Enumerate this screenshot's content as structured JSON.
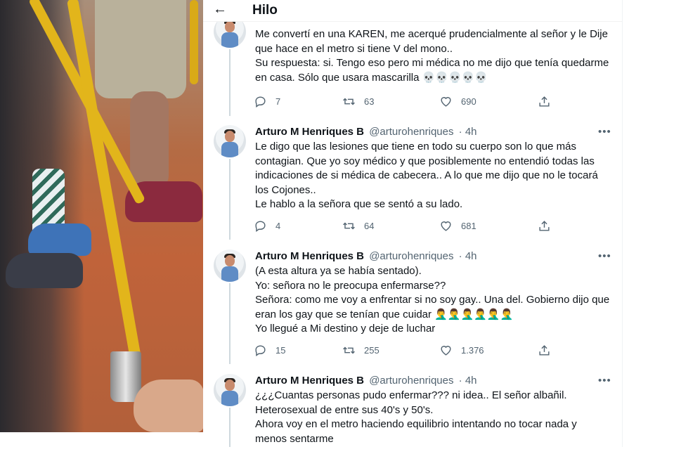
{
  "header": {
    "title": "Hilo"
  },
  "tweets": [
    {
      "name": "",
      "handle": "",
      "time": "",
      "lines": [
        "Me convertí en una KAREN, me acerqué prudencialmente al señor y le Dije",
        "que hace en el metro si tiene V del mono..",
        "Su respuesta: si. Tengo eso pero mi médica no me dijo que tenía quedarme",
        "en casa. Sólo que usara mascarilla 💀💀💀💀💀"
      ],
      "replies": "7",
      "retweets": "63",
      "likes": "690"
    },
    {
      "name": "Arturo M Henriques B",
      "handle": "@arturohenriques",
      "time": "· 4h",
      "lines": [
        "Le digo que las lesiones que tiene en todo su cuerpo son lo que más",
        "contagian. Que yo soy médico y que posiblemente no entendió todas las",
        "indicaciones de si médica de cabecera.. A lo que me dijo que no le tocará",
        "los Cojones..",
        "Le hablo a la señora que se sentó a su lado."
      ],
      "replies": "4",
      "retweets": "64",
      "likes": "681"
    },
    {
      "name": "Arturo M Henriques B",
      "handle": "@arturohenriques",
      "time": "· 4h",
      "lines": [
        "(A esta altura ya se había sentado).",
        "Yo: señora no le preocupa enfermarse??",
        "Señora: como me voy a enfrentar si no soy gay.. Una del. Gobierno dijo que",
        "eran los gay que se tenían que cuidar 🤦‍♂️🤦‍♂️🤦‍♂️🤦‍♂️🤦‍♂️🤦‍♂️",
        "Yo llegué a Mi destino y deje de luchar"
      ],
      "replies": "15",
      "retweets": "255",
      "likes": "1.376"
    },
    {
      "name": "Arturo M Henriques B",
      "handle": "@arturohenriques",
      "time": "· 4h",
      "lines": [
        "¿¿¿Cuantas personas pudo enfermar??? ni idea.. El señor albañil.",
        "Heterosexual de entre sus 40's y 50's.",
        "Ahora voy en el metro haciendo equilibrio intentando no tocar nada y",
        "menos sentarme"
      ]
    }
  ],
  "more_glyph": "•••",
  "colors": {
    "text": "#0f1419",
    "muted": "#536471",
    "thread_line": "#cfd9de",
    "pole": "#e2b51b"
  },
  "icons": [
    "back-arrow-icon",
    "reply-icon",
    "retweet-icon",
    "like-icon",
    "share-icon",
    "more-icon"
  ]
}
